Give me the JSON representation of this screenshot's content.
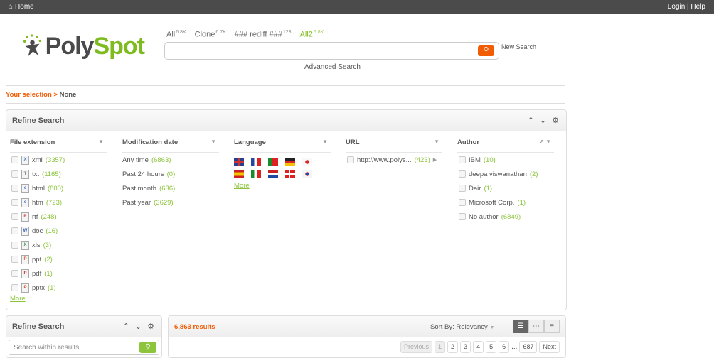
{
  "topbar": {
    "home": "Home",
    "login": "Login",
    "sep": "|",
    "help": "Help"
  },
  "logo": {
    "part1": "Poly",
    "part2": "Spot"
  },
  "tabs": [
    {
      "label": "All",
      "count": "6.8K"
    },
    {
      "label": "Clone",
      "count": "6.7K"
    },
    {
      "label": "### rediff ###",
      "count": "123"
    },
    {
      "label": "All2",
      "count": "6.8K"
    }
  ],
  "search": {
    "value": "",
    "new_search": "New Search",
    "advanced": "Advanced Search"
  },
  "selection": {
    "label": "Your selection >",
    "value": "None"
  },
  "refine": {
    "title": "Refine Search",
    "file_extension": {
      "title": "File extension",
      "items": [
        {
          "label": "xml",
          "count": "(3357)",
          "icon": "xml"
        },
        {
          "label": "txt",
          "count": "(1165)",
          "icon": "txt"
        },
        {
          "label": "html",
          "count": "(800)",
          "icon": "ie"
        },
        {
          "label": "htm",
          "count": "(723)",
          "icon": "ie"
        },
        {
          "label": "rtf",
          "count": "(248)",
          "icon": "rtf"
        },
        {
          "label": "doc",
          "count": "(16)",
          "icon": "W"
        },
        {
          "label": "xls",
          "count": "(3)",
          "icon": "X"
        },
        {
          "label": "ppt",
          "count": "(2)",
          "icon": "P"
        },
        {
          "label": "pdf",
          "count": "(1)",
          "icon": "pdf"
        },
        {
          "label": "pptx",
          "count": "(1)",
          "icon": "P"
        }
      ],
      "more": "More"
    },
    "modification_date": {
      "title": "Modification date",
      "items": [
        {
          "label": "Any time",
          "count": "(6863)"
        },
        {
          "label": "Past 24 hours",
          "count": "(0)"
        },
        {
          "label": "Past month",
          "count": "(636)"
        },
        {
          "label": "Past year",
          "count": "(3629)"
        }
      ]
    },
    "language": {
      "title": "Language",
      "flags": [
        "gb",
        "fr",
        "pt",
        "de",
        "jp",
        "es",
        "it",
        "nl",
        "dk",
        "kr"
      ],
      "more": "More"
    },
    "url": {
      "title": "URL",
      "items": [
        {
          "label": "http://www.polys...",
          "count": "(423)"
        }
      ]
    },
    "author": {
      "title": "Author",
      "items": [
        {
          "label": "IBM",
          "count": "(10)"
        },
        {
          "label": "deepa viswanathan",
          "count": "(2)"
        },
        {
          "label": "Dair",
          "count": "(1)"
        },
        {
          "label": "Microsoft Corp.",
          "count": "(1)"
        },
        {
          "label": "No author",
          "count": "(6849)"
        }
      ]
    }
  },
  "refine2": {
    "title": "Refine Search",
    "placeholder": "Search within results"
  },
  "results": {
    "count": "6,863 results",
    "sort": "Sort By: Relevancy",
    "pager": {
      "prev": "Previous",
      "pages": [
        "1",
        "2",
        "3",
        "4",
        "5",
        "6"
      ],
      "ellipsis": "...",
      "last": "687",
      "next": "Next"
    }
  },
  "colors": {
    "accent": "#f25c05",
    "green": "#8cc43c",
    "topbar": "#4b4b4b"
  }
}
